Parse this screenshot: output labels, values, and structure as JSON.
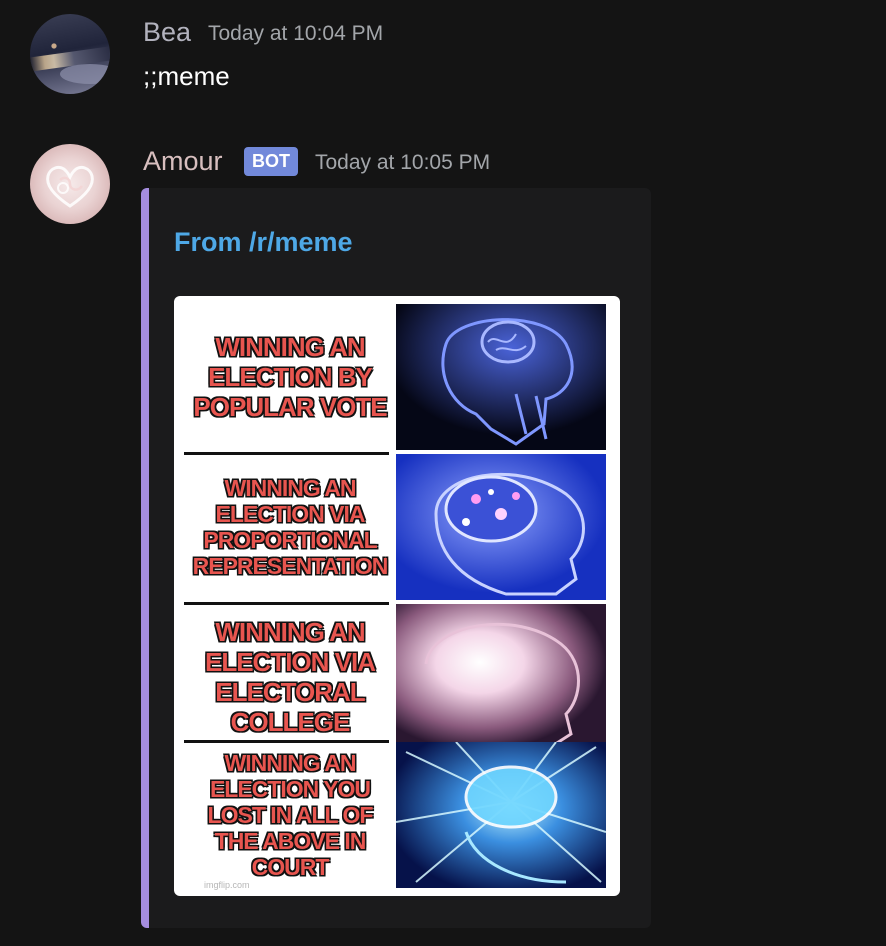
{
  "messages": [
    {
      "username": "Bea",
      "timestamp": "Today at 10:04 PM",
      "text": ";;meme",
      "avatar_icon": "user-avatar-landscape"
    },
    {
      "username": "Amour",
      "badge": "BOT",
      "timestamp": "Today at 10:05 PM",
      "avatar_icon": "bot-avatar-heart",
      "embed": {
        "title": "From /r/meme",
        "accent_color": "#a58ddf",
        "image": {
          "template": "expanding-brain",
          "panels": [
            "WINNING AN\nELECTION BY\nPOPULAR VOTE",
            "WINNING AN\nELECTION VIA\nPROPORTIONAL\nREPRESENTATION",
            "WINNING AN\nELECTION VIA\nELECTORAL COLLEGE",
            "WINNING AN\nELECTION YOU\nLOST IN ALL OF\nTHE ABOVE IN COURT"
          ],
          "watermark": "imgflip.com"
        }
      }
    }
  ],
  "colors": {
    "background": "#141414",
    "bot_badge": "#7289da",
    "embed_title": "#4ea8e6",
    "meme_text": "#e8554f"
  }
}
